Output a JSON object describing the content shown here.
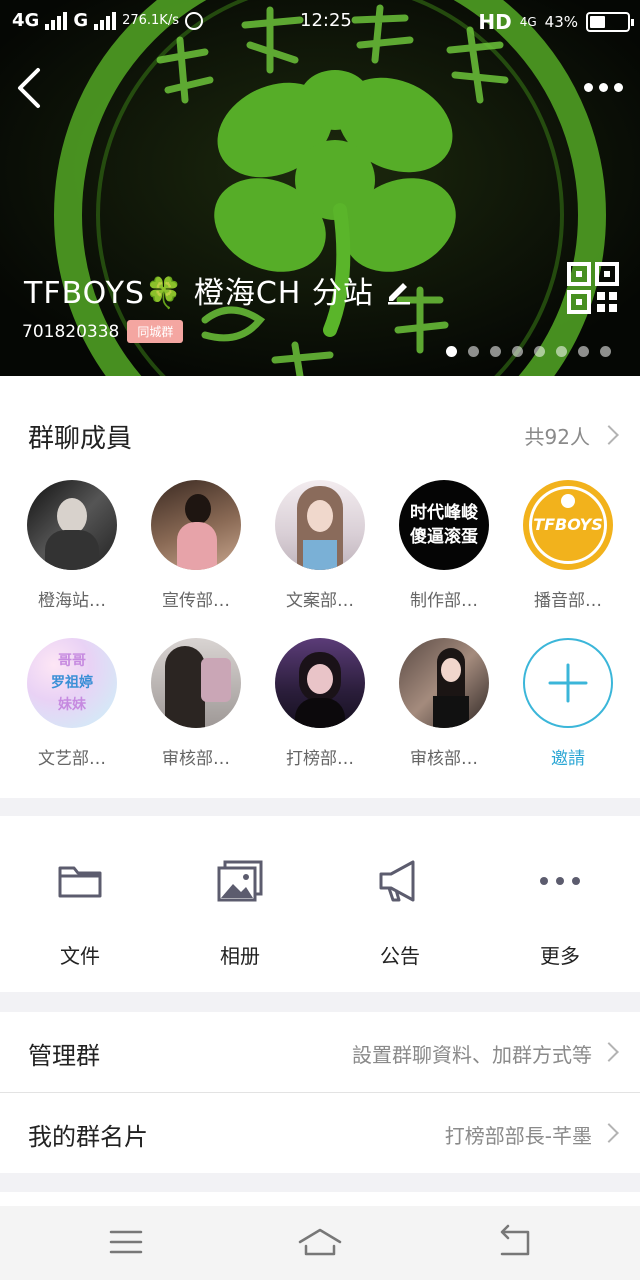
{
  "status_bar": {
    "network_1": "4G",
    "network_2": "G",
    "speed": "276.1K/s",
    "time": "12:25",
    "hd": "HD",
    "network_3": "4G",
    "battery": "43%",
    "battery_level": 0.43
  },
  "header": {
    "group_name": "TFBOYS🍀 橙海CH  分站",
    "group_id": "701820338",
    "badge": "同城群",
    "page_count": 8,
    "current_page": 1,
    "accent": "#5bbd2b"
  },
  "members": {
    "title": "群聊成員",
    "count": "共92人",
    "list": [
      {
        "name": "橙海站…",
        "avatar": "photo-dark"
      },
      {
        "name": "宣传部…",
        "avatar": "photo-warm"
      },
      {
        "name": "文案部…",
        "avatar": "photo-light"
      },
      {
        "name": "制作部…",
        "avatar": "text-black",
        "avatar_text": [
          "时代峰峻",
          "傻逼滚蛋"
        ]
      },
      {
        "name": "播音部…",
        "avatar": "tfboys-logo",
        "avatar_text": [
          "TFBOYS"
        ]
      },
      {
        "name": "文艺部…",
        "avatar": "text-pastel",
        "avatar_text": [
          "哥哥",
          "罗祖婷",
          "妹妹"
        ]
      },
      {
        "name": "审核部…",
        "avatar": "photo-gray"
      },
      {
        "name": "打榜部…",
        "avatar": "photo-purple"
      },
      {
        "name": "审核部…",
        "avatar": "photo-night"
      }
    ],
    "invite_label": "邀請"
  },
  "functions": [
    {
      "label": "文件",
      "icon": "folder-icon"
    },
    {
      "label": "相册",
      "icon": "album-icon"
    },
    {
      "label": "公告",
      "icon": "megaphone-icon"
    },
    {
      "label": "更多",
      "icon": "more-icon"
    }
  ],
  "settings": {
    "manage": {
      "label": "管理群",
      "value": "設置群聊資料、加群方式等"
    },
    "card": {
      "label": "我的群名片",
      "value": "打榜部部長-芊墨"
    }
  },
  "colors": {
    "invite": "#3bb6d9",
    "icon_gray": "#5c5c6e",
    "badge": "#f4a6a1"
  }
}
